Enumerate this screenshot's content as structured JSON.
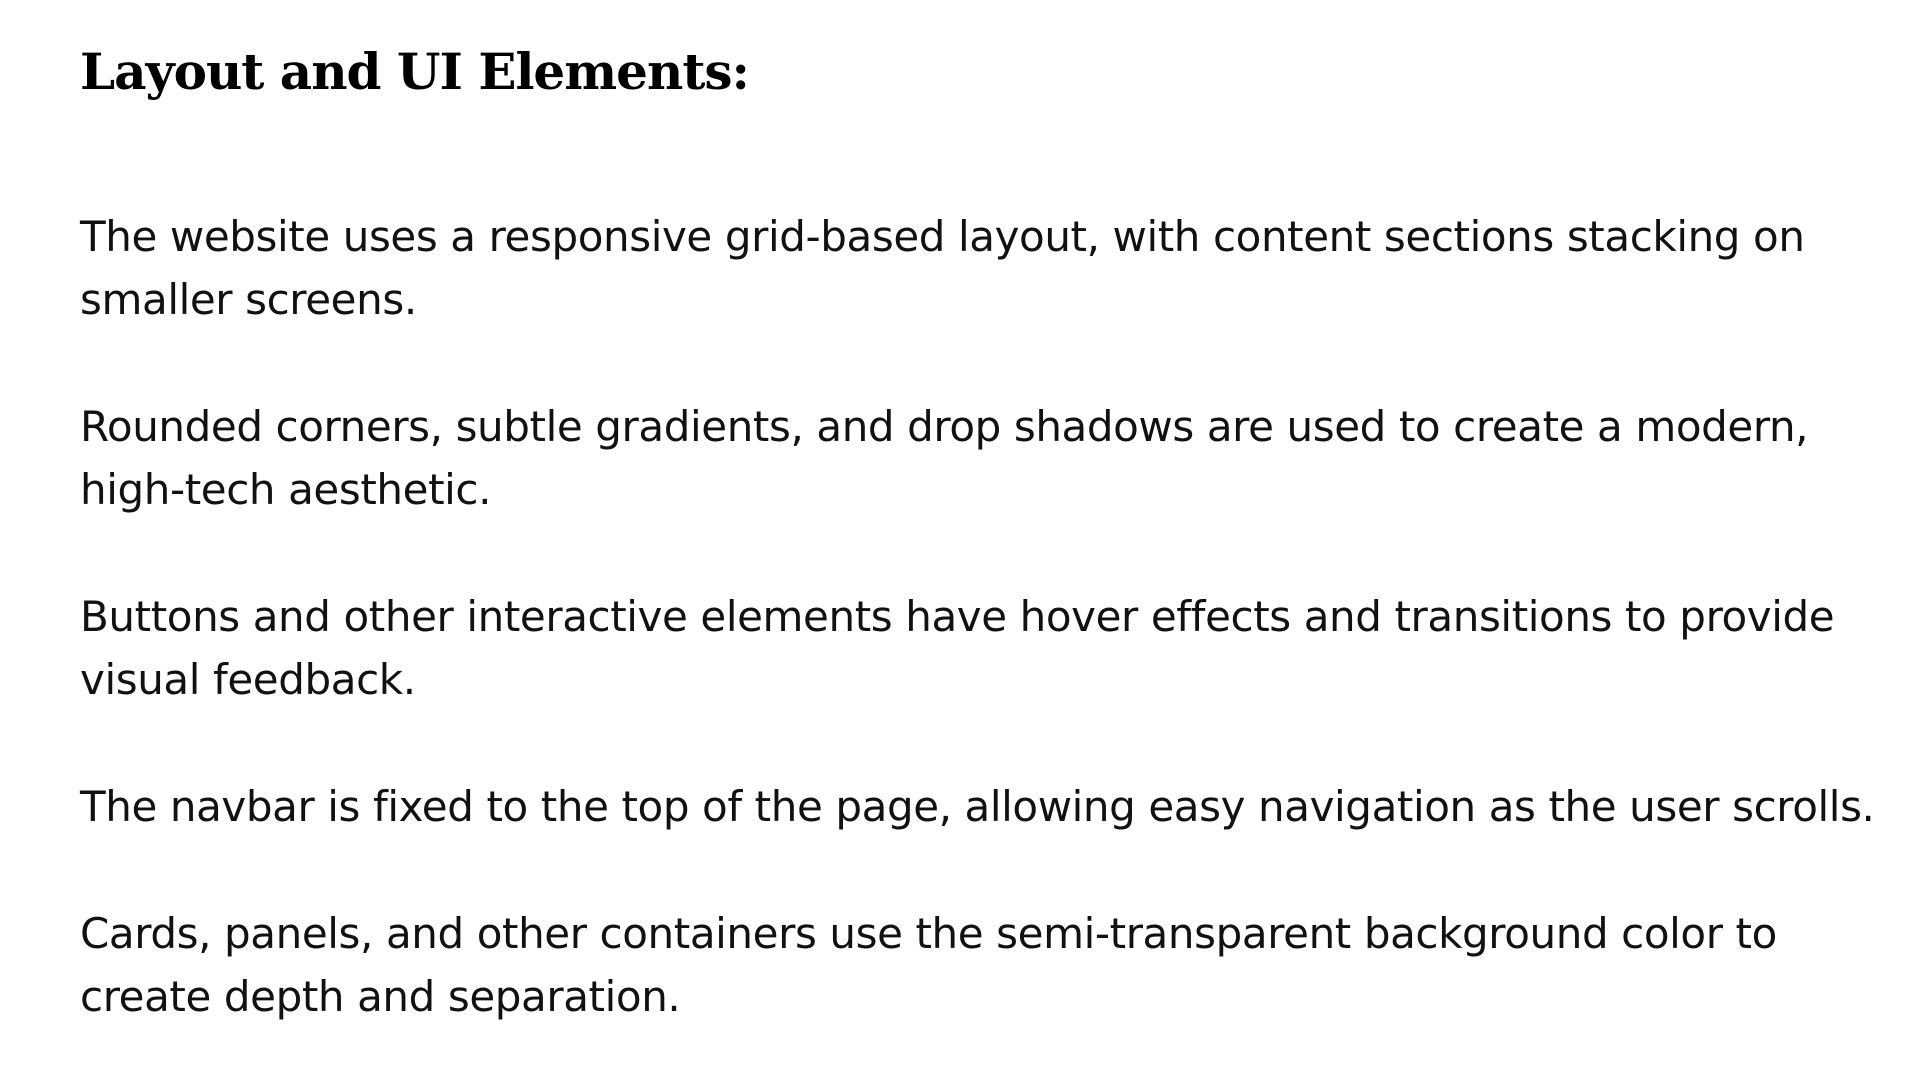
{
  "document": {
    "heading": "Layout and UI Elements:",
    "paragraphs": [
      "The website uses a responsive grid-based layout, with content sections stacking on smaller screens.",
      "Rounded corners, subtle gradients, and drop shadows are used to create a modern, high-tech aesthetic.",
      "Buttons and other interactive elements have hover effects and transitions to provide visual feedback.",
      "The navbar is fixed to the top of the page, allowing easy navigation as the user scrolls.",
      "Cards, panels, and other containers use the semi-transparent background color to create depth and separation."
    ]
  }
}
